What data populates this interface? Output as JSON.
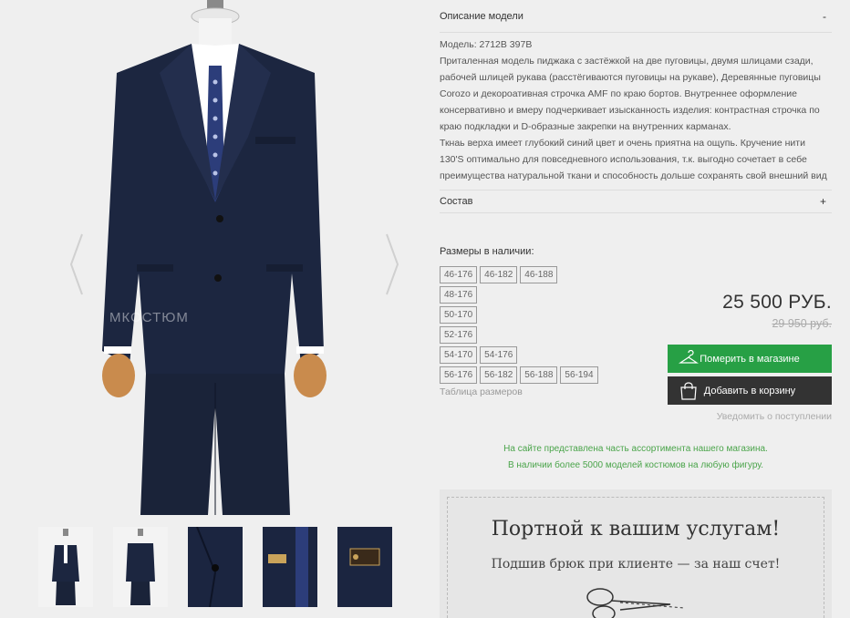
{
  "gallery": {
    "watermark": "МКОСТЮМ",
    "thumbnails": [
      "front-view",
      "back-view",
      "button-detail",
      "tie-detail",
      "label-detail"
    ]
  },
  "description": {
    "header_label": "Описание модели",
    "toggle": "-",
    "paragraphs": [
      "Модель: 2712B 397B",
      "Приталенная модель пиджака с застёжкой на две пуговицы, двумя шлицами сзади, рабочей шлицей рукава (расстёгиваются пуговицы на рукаве), Деревянные пуговицы Corozo и декороативная строчка  AMF по краю бортов. Внутреннее оформление консервативно и вмеру подчеркивает изысканность изделия: контрастная строчка по краю подкладки и D-образные закрепки на внутренних карманах.",
      "Ткнаь верха имеет глубокий синий цвет и очень приятна на ощупь. Кручение нити 130'S оптимально для повседневного использования, т.к. выгодно сочетает в себе преимущества натуральной ткани и способность дольше сохранять свой внешний вид"
    ]
  },
  "composition": {
    "header_label": "Состав",
    "toggle": "+"
  },
  "sizes": {
    "title": "Размеры в наличии:",
    "rows": [
      [
        "46-176",
        "46-182",
        "46-188"
      ],
      [
        "48-176"
      ],
      [
        "50-170"
      ],
      [
        "52-176"
      ],
      [
        "54-170",
        "54-176"
      ],
      [
        "56-176",
        "56-182",
        "56-188",
        "56-194"
      ]
    ],
    "table_link": "Таблица размеров"
  },
  "price": {
    "current": "25 500 РУБ.",
    "old": "29 950 руб."
  },
  "actions": {
    "try_in_store": "Померить в магазине",
    "add_to_cart": "Добавить в корзину",
    "notify": "Уведомить о поступлении"
  },
  "notice": {
    "line1": "На сайте представлена часть ассортимента нашего магазина.",
    "line2": "В наличии более 5000 моделей костюмов на любую фигуру."
  },
  "tailor": {
    "title": "Портной к вашим услугам!",
    "subtitle": "Подшив брюк при клиенте — за наш счет!"
  },
  "colors": {
    "accent_green": "#27a045",
    "dark_button": "#333333",
    "notice_green": "#4aa44a",
    "suit_navy": "#1c2640"
  }
}
